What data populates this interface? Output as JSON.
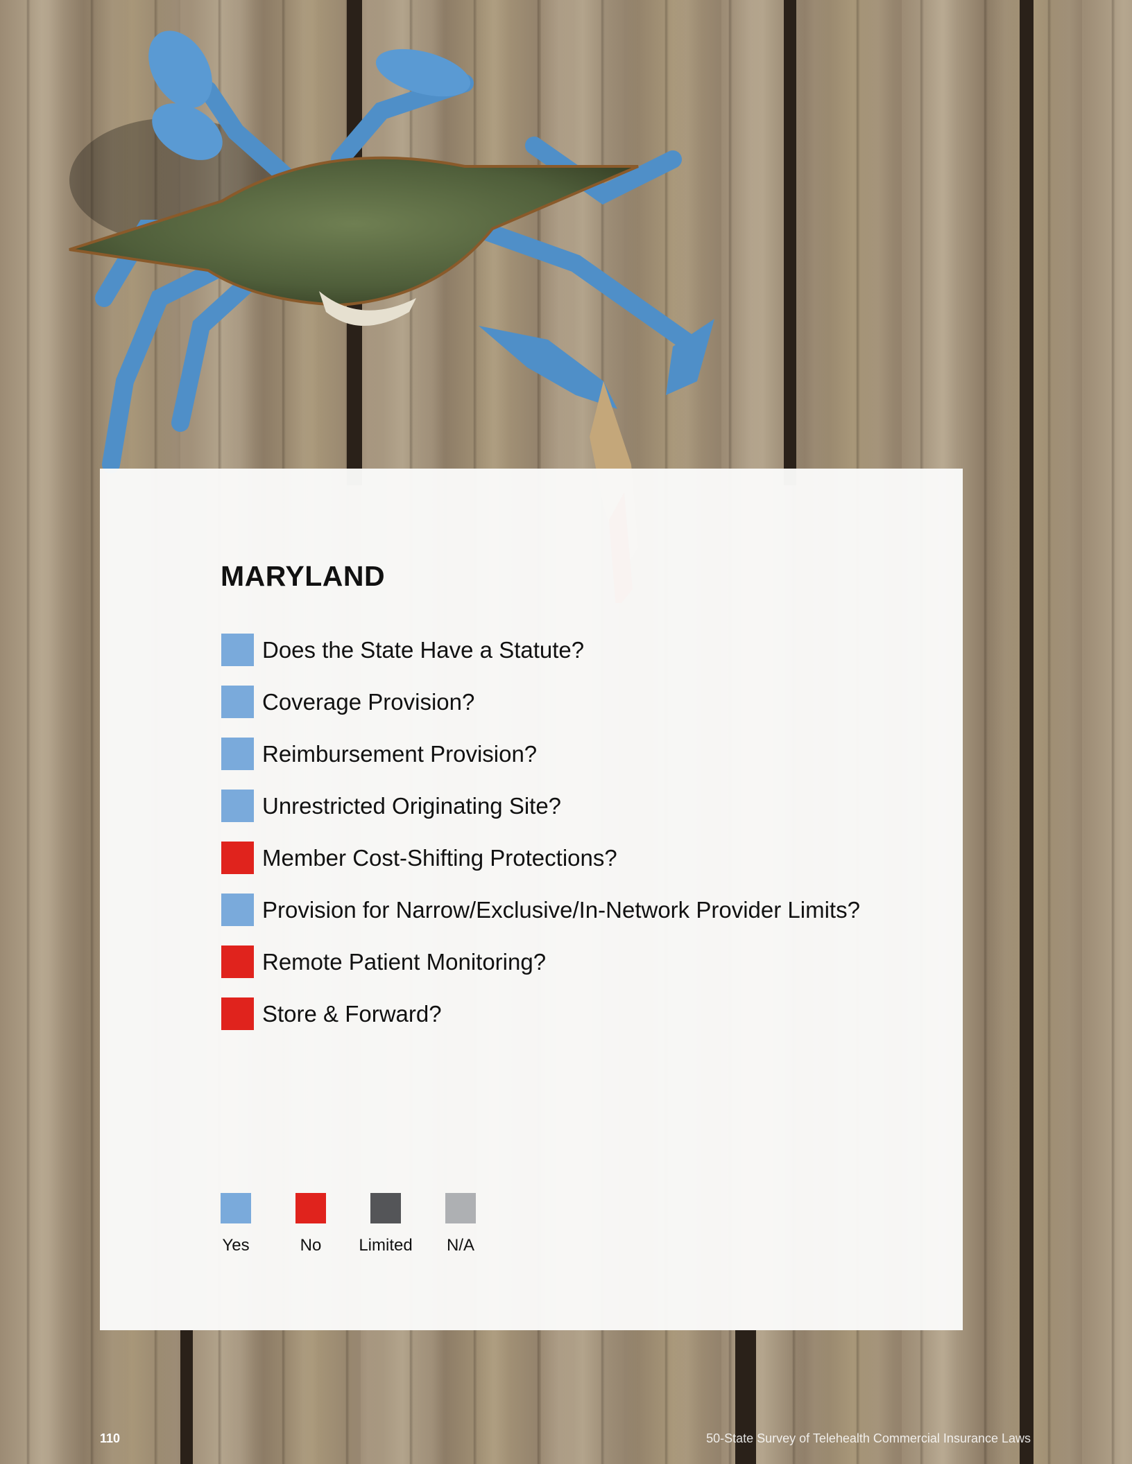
{
  "state": "MARYLAND",
  "colors": {
    "yes": "#7aaadb",
    "no": "#e0231d",
    "limited": "#545558",
    "na": "#aeb0b3"
  },
  "questions": [
    {
      "label": "Does the State Have a Statute?",
      "status": "yes"
    },
    {
      "label": "Coverage Provision?",
      "status": "yes"
    },
    {
      "label": "Reimbursement Provision?",
      "status": "yes"
    },
    {
      "label": "Unrestricted Originating Site?",
      "status": "yes"
    },
    {
      "label": "Member Cost-Shifting Protections?",
      "status": "no"
    },
    {
      "label": "Provision for Narrow/Exclusive/In-Network Provider Limits?",
      "status": "yes"
    },
    {
      "label": "Remote Patient Monitoring?",
      "status": "no"
    },
    {
      "label": "Store & Forward?",
      "status": "no"
    }
  ],
  "legend": [
    {
      "label": "Yes",
      "status": "yes"
    },
    {
      "label": "No",
      "status": "no"
    },
    {
      "label": "Limited",
      "status": "limited"
    },
    {
      "label": "N/A",
      "status": "na"
    }
  ],
  "footer": {
    "page_number": "110",
    "publication_title": "50-State Survey of Telehealth Commercial Insurance Laws"
  },
  "background_image": "blue-crab-on-wooden-dock"
}
